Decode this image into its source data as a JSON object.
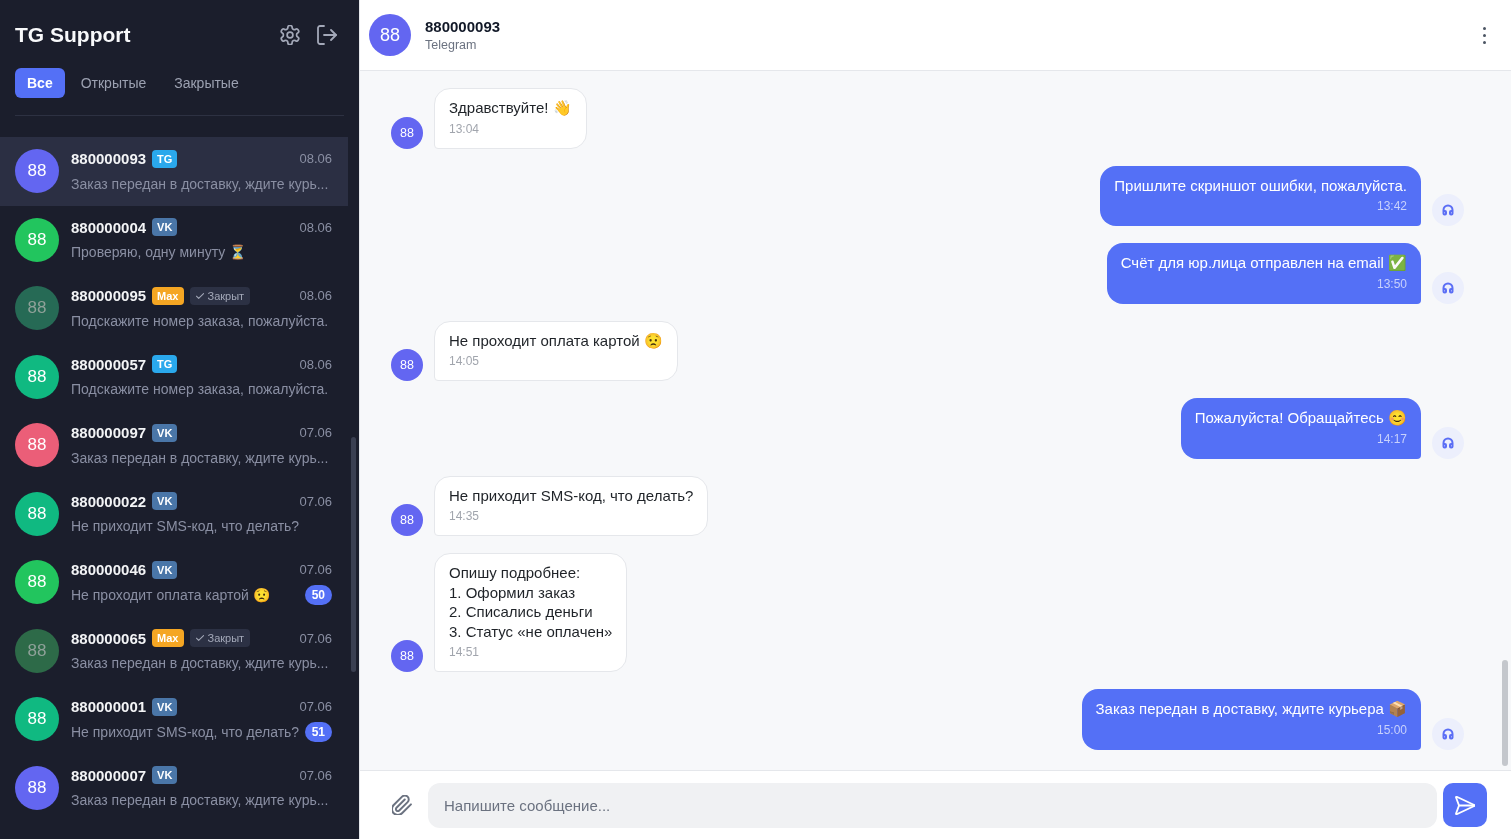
{
  "sidebar": {
    "title": "TG Support",
    "tabs": [
      {
        "label": "Все",
        "selected": true
      },
      {
        "label": "Открытые",
        "selected": false
      },
      {
        "label": "Закрытые",
        "selected": false
      }
    ],
    "conversations": [
      {
        "avatar": {
          "initials": "88",
          "color": "#6366f1"
        },
        "name": "880000093",
        "channel": {
          "label": "TG",
          "color": "#2aa8ec"
        },
        "closed": false,
        "date": "08.06",
        "preview": "Заказ передан в доставку, ждите курь...",
        "selected": true
      },
      {
        "avatar": {
          "initials": "88",
          "color": "#22c55e"
        },
        "name": "880000004",
        "channel": {
          "label": "VK",
          "color": "#4a76a8"
        },
        "closed": false,
        "date": "08.06",
        "preview": "Проверяю, одну минуту ⏳",
        "selected": false
      },
      {
        "avatar": {
          "initials": "88",
          "color": "#266a55"
        },
        "name": "880000095",
        "channel": {
          "label": "Max",
          "color": "#f5a623"
        },
        "closed": true,
        "status": "Закрыт",
        "date": "08.06",
        "preview": "Подскажите номер заказа, пожалуйста.",
        "selected": false
      },
      {
        "avatar": {
          "initials": "88",
          "color": "#10b981"
        },
        "name": "880000057",
        "channel": {
          "label": "TG",
          "color": "#2aa8ec"
        },
        "closed": false,
        "date": "08.06",
        "preview": "Подскажите номер заказа, пожалуйста.",
        "selected": false
      },
      {
        "avatar": {
          "initials": "88",
          "color": "#eb5e78"
        },
        "name": "880000097",
        "channel": {
          "label": "VK",
          "color": "#4a76a8"
        },
        "closed": false,
        "date": "07.06",
        "preview": "Заказ передан в доставку, ждите курь...",
        "selected": false
      },
      {
        "avatar": {
          "initials": "88",
          "color": "#10b981"
        },
        "name": "880000022",
        "channel": {
          "label": "VK",
          "color": "#4a76a8"
        },
        "closed": false,
        "date": "07.06",
        "preview": "Не приходит SMS-код, что делать?",
        "selected": false
      },
      {
        "avatar": {
          "initials": "88",
          "color": "#22c55e"
        },
        "name": "880000046",
        "channel": {
          "label": "VK",
          "color": "#4a76a8"
        },
        "closed": false,
        "date": "07.06",
        "preview": "Не проходит оплата картой 😟",
        "unread": "50",
        "selected": false
      },
      {
        "avatar": {
          "initials": "88",
          "color": "#2d6a48"
        },
        "name": "880000065",
        "channel": {
          "label": "Max",
          "color": "#f5a623"
        },
        "closed": true,
        "status": "Закрыт",
        "date": "07.06",
        "preview": "Заказ передан в доставку, ждите курь...",
        "selected": false
      },
      {
        "avatar": {
          "initials": "88",
          "color": "#10b981"
        },
        "name": "880000001",
        "channel": {
          "label": "VK",
          "color": "#4a76a8"
        },
        "closed": false,
        "date": "07.06",
        "preview": "Не приходит SMS-код, что делать?",
        "unread": "51",
        "selected": false
      },
      {
        "avatar": {
          "initials": "88",
          "color": "#6366f1"
        },
        "name": "880000007",
        "channel": {
          "label": "VK",
          "color": "#4a76a8"
        },
        "closed": false,
        "date": "07.06",
        "preview": "Заказ передан в доставку, ждите курь...",
        "selected": false
      }
    ]
  },
  "chat": {
    "contact": {
      "initials": "88",
      "name": "880000093",
      "channel": "Telegram"
    },
    "messages": [
      {
        "kind": "incoming",
        "avatar": "88",
        "text": "Здравствуйте! 👋",
        "time": "13:04"
      },
      {
        "kind": "outgoing",
        "text": "Пришлите скриншот ошибки, пожалуйста.",
        "time": "13:42"
      },
      {
        "kind": "outgoing",
        "text": "Счёт для юр.лица отправлен на email ✅",
        "time": "13:50"
      },
      {
        "kind": "incoming",
        "avatar": "88",
        "text": "Не проходит оплата картой 😟",
        "time": "14:05"
      },
      {
        "kind": "outgoing",
        "text": "Пожалуйста! Обращайтесь 😊",
        "time": "14:17"
      },
      {
        "kind": "incoming",
        "avatar": "88",
        "text": "Не приходит SMS-код, что делать?",
        "time": "14:35"
      },
      {
        "kind": "incoming",
        "avatar": "88",
        "text": "Опишу подробнее:\n1. Оформил заказ\n2. Списались деньги\n3. Статус «не оплачен»",
        "time": "14:51"
      },
      {
        "kind": "outgoing",
        "text": "Заказ передан в доставку, ждите курьера 📦",
        "time": "15:00"
      }
    ],
    "composer": {
      "placeholder": "Напишите сообщение..."
    }
  }
}
